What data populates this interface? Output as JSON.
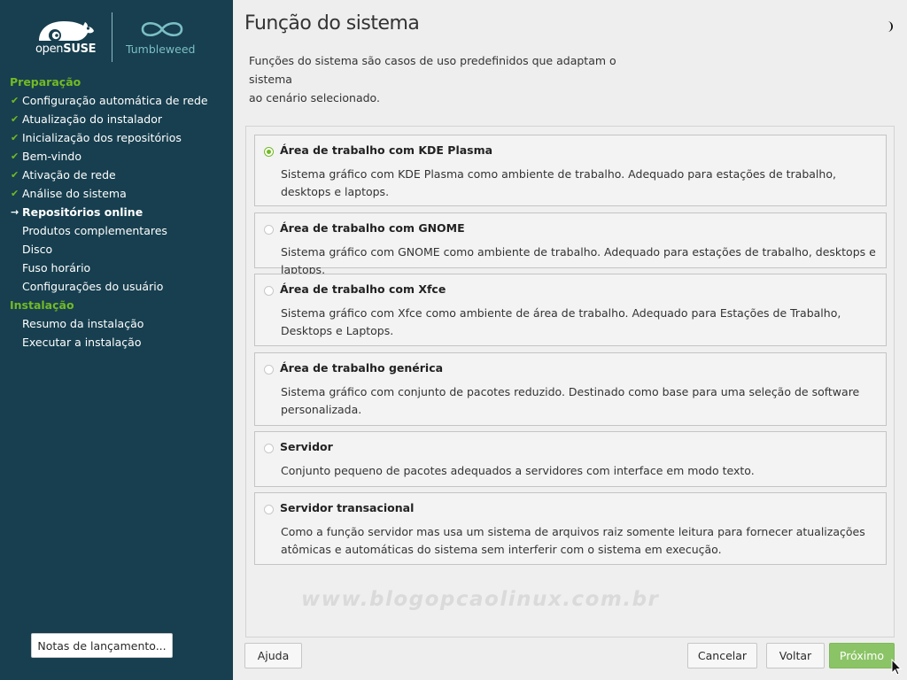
{
  "colors": {
    "sidebar_bg": "#173f4f",
    "accent_green": "#73ba25",
    "next_button_bg": "#8bc466",
    "tumbleweed_teal": "#7bbfc4"
  },
  "branding": {
    "opensuse_prefix": "open",
    "opensuse_suffix": "SUSE",
    "product": "Tumbleweed",
    "logo_icon": "gecko-icon",
    "product_icon": "infinity-icon"
  },
  "sidebar": {
    "sections": [
      {
        "title": "Preparação",
        "steps": [
          {
            "label": "Configuração automática de rede",
            "state": "done"
          },
          {
            "label": "Atualização do instalador",
            "state": "done"
          },
          {
            "label": "Inicialização dos repositórios",
            "state": "done"
          },
          {
            "label": "Bem-vindo",
            "state": "done"
          },
          {
            "label": "Ativação de rede",
            "state": "done"
          },
          {
            "label": "Análise do sistema",
            "state": "done"
          },
          {
            "label": "Repositórios online",
            "state": "current"
          },
          {
            "label": "Produtos complementares",
            "state": "pending"
          },
          {
            "label": "Disco",
            "state": "pending"
          },
          {
            "label": "Fuso horário",
            "state": "pending"
          },
          {
            "label": "Configurações do usuário",
            "state": "pending"
          }
        ]
      },
      {
        "title": "Instalação",
        "steps": [
          {
            "label": "Resumo da instalação",
            "state": "pending"
          },
          {
            "label": "Executar a instalação",
            "state": "pending"
          }
        ]
      }
    ],
    "release_notes_button": "Notas de lançamento..."
  },
  "header": {
    "title": "Função do sistema",
    "intro_line1": "Funções do sistema são casos de uso predefinidos que adaptam o sistema",
    "intro_line2": "ao cenário selecionado."
  },
  "roles": [
    {
      "title": "Área de trabalho com KDE Plasma",
      "description": "Sistema gráfico com KDE Plasma como ambiente de trabalho. Adequado para estações de trabalho, desktops e laptops.",
      "selected": true
    },
    {
      "title": "Área de trabalho com GNOME",
      "description": "Sistema gráfico com GNOME como ambiente de trabalho. Adequado para estações de trabalho, desktops e laptops.",
      "selected": false
    },
    {
      "title": "Área de trabalho com Xfce",
      "description": "Sistema gráfico com Xfce como ambiente de área de trabalho. Adequado para Estações de Trabalho, Desktops e Laptops.",
      "selected": false
    },
    {
      "title": "Área de trabalho genérica",
      "description": "Sistema gráfico com conjunto de pacotes reduzido. Destinado como base para uma seleção de software personalizada.",
      "selected": false
    },
    {
      "title": "Servidor",
      "description": "Conjunto pequeno de pacotes adequados a servidores com interface em modo texto.",
      "selected": false
    },
    {
      "title": "Servidor transacional",
      "description": "Como a função servidor mas usa um sistema de arquivos raiz somente leitura para fornecer atualizações atômicas e automáticas do sistema sem interferir com o sistema em execução.",
      "selected": false
    }
  ],
  "watermark": "www.blogopcaolinux.com.br",
  "footer": {
    "help": "Ajuda",
    "cancel": "Cancelar",
    "back": "Voltar",
    "next": "Próximo"
  }
}
